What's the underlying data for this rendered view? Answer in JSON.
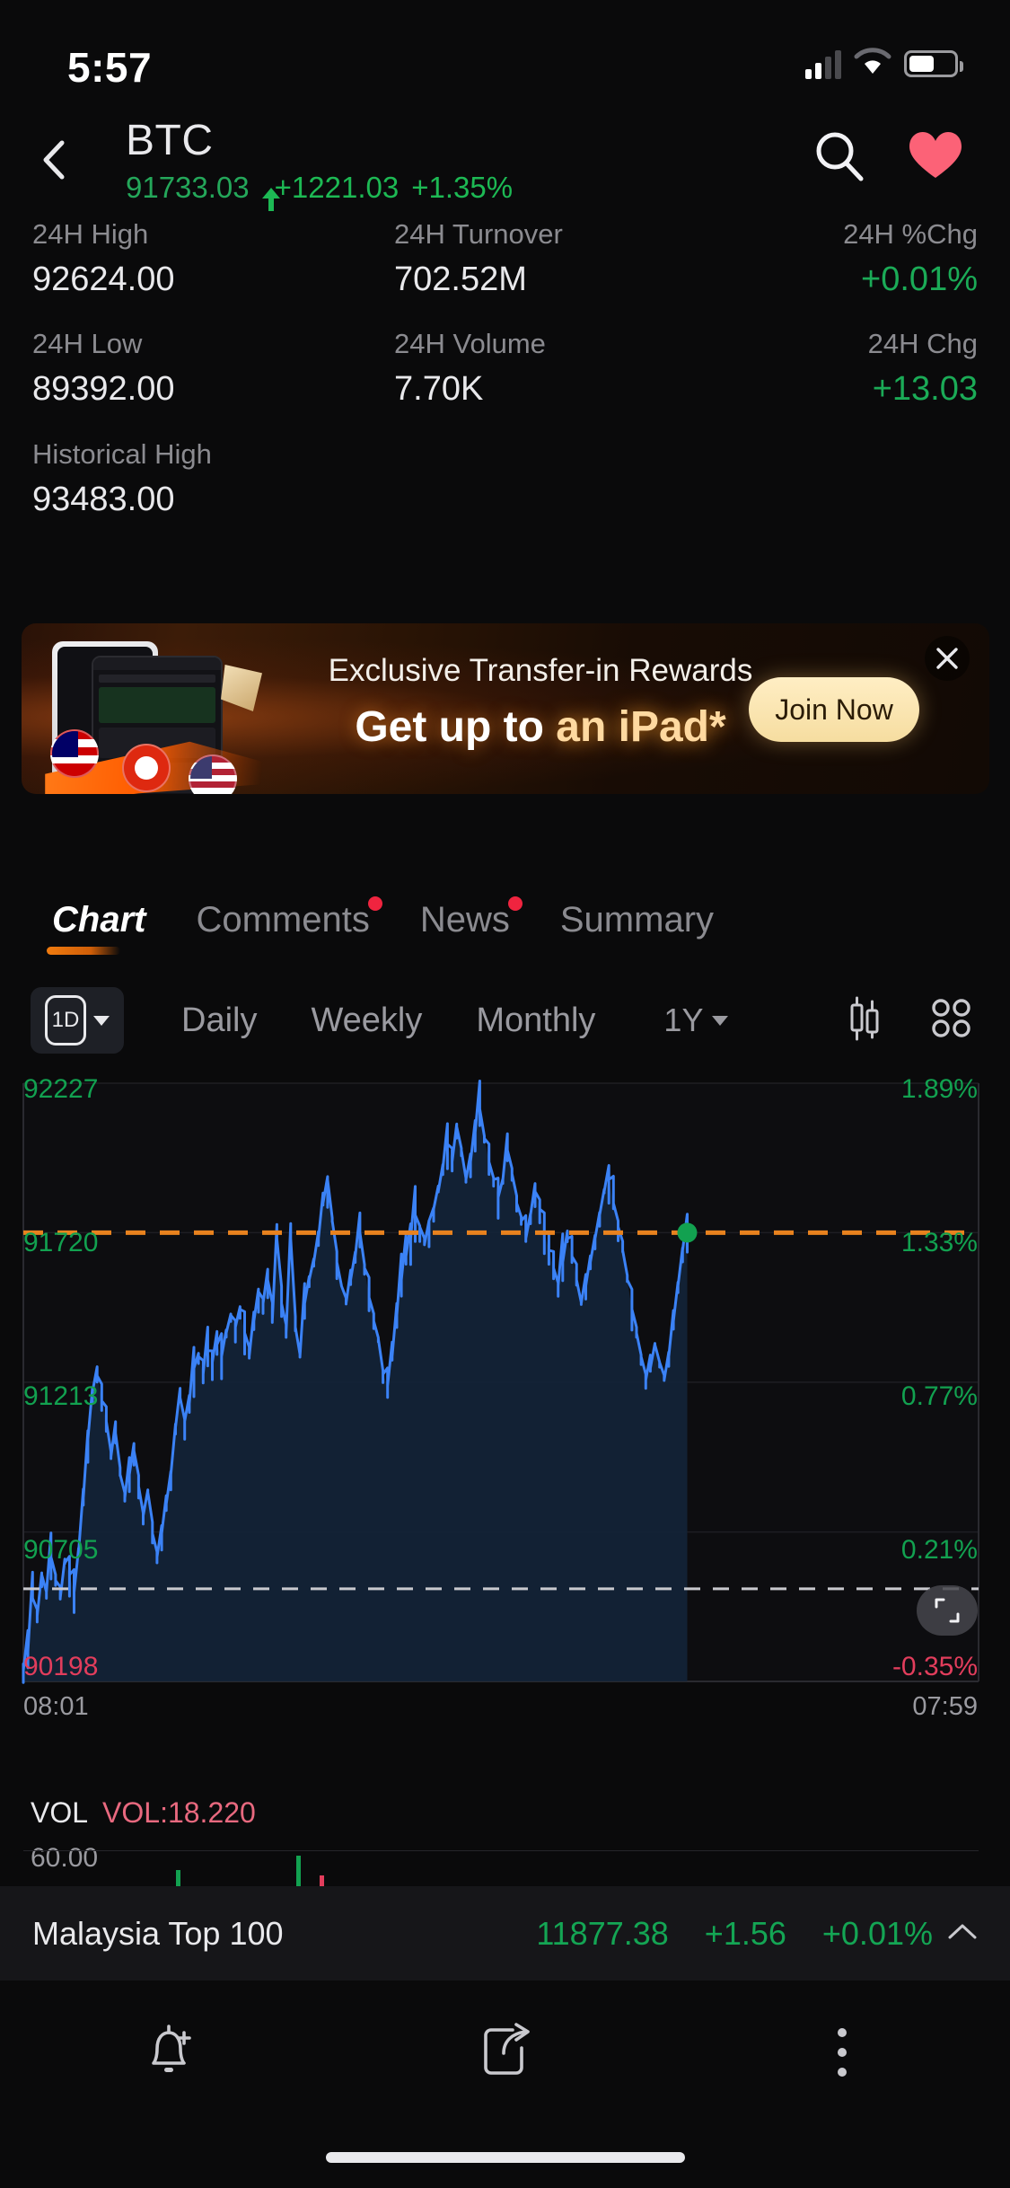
{
  "status_bar": {
    "time": "5:57",
    "signal_icon": "cellular-signal-icon",
    "wifi_icon": "wifi-icon",
    "battery_icon": "battery-icon"
  },
  "header": {
    "back_icon": "back-chevron-icon",
    "symbol": "BTC",
    "last_price": "91733.03",
    "direction_icon": "arrow-up-icon",
    "change_abs": "+1221.03",
    "change_pct": "+1.35%",
    "search_icon": "search-icon",
    "favorite_icon": "heart-icon"
  },
  "stats": [
    [
      {
        "label": "24H High",
        "value": "92624.00",
        "tone": "neutral"
      },
      {
        "label": "24H Turnover",
        "value": "702.52M",
        "tone": "neutral"
      },
      {
        "label": "24H %Chg",
        "value": "+0.01%",
        "tone": "up"
      }
    ],
    [
      {
        "label": "24H Low",
        "value": "89392.00",
        "tone": "neutral"
      },
      {
        "label": "24H Volume",
        "value": "7.70K",
        "tone": "neutral"
      },
      {
        "label": "24H Chg",
        "value": "+13.03",
        "tone": "up"
      }
    ],
    [
      {
        "label": "Historical High",
        "value": "93483.00",
        "tone": "neutral"
      }
    ]
  ],
  "banner": {
    "subtitle": "Exclusive Transfer-in Rewards",
    "title_plain": "Get up to ",
    "title_accent": "an iPad*",
    "cta_label": "Join Now",
    "close_icon": "close-icon",
    "flags": [
      "malaysia-flag-icon",
      "hong-kong-flag-icon",
      "usa-flag-icon"
    ]
  },
  "tabs": [
    {
      "label": "Chart",
      "active": true,
      "badge": false
    },
    {
      "label": "Comments",
      "active": false,
      "badge": true
    },
    {
      "label": "News",
      "active": false,
      "badge": true
    },
    {
      "label": "Summary",
      "active": false,
      "badge": false
    }
  ],
  "chart_controls": {
    "period_chip": "1D",
    "chip_caret_icon": "chevron-down-icon",
    "items": [
      "Daily",
      "Weekly",
      "Monthly"
    ],
    "range_label": "1Y",
    "range_caret_icon": "chevron-down-icon",
    "candle_icon": "candlestick-icon",
    "grid_icon": "grid-layout-icon",
    "expand_icon": "fullscreen-expand-icon"
  },
  "chart_data": {
    "type": "line",
    "title": "BTC intraday price",
    "xlabel": "",
    "ylabel": "",
    "x_ticks": [
      "08:01",
      "07:59"
    ],
    "y_ticks": [
      "92227",
      "91720",
      "91213",
      "90705",
      "90198"
    ],
    "y_tick_tones": [
      "up",
      "up",
      "up",
      "up",
      "down"
    ],
    "right_ticks": [
      "1.89%",
      "1.33%",
      "0.77%",
      "0.21%",
      "-0.35%"
    ],
    "right_tick_tones": [
      "up",
      "up",
      "up",
      "up",
      "down"
    ],
    "ylim": [
      90198,
      92227
    ],
    "prev_close_line": 91720,
    "prev_close_pct": "1.33%",
    "baseline_line": 90512,
    "last_point_marker": "green-dot",
    "line_color": "#3b82f6",
    "fill_color": "#132438",
    "prev_close_color": "#e8821e",
    "up_color": "#12a150",
    "down_color": "#e23d5c",
    "grid": true,
    "values": [
      90235,
      90300,
      90480,
      90420,
      90560,
      90500,
      90620,
      90540,
      90480,
      90600,
      90560,
      90500,
      90640,
      90820,
      91020,
      91180,
      91235,
      91150,
      91080,
      90960,
      91040,
      90900,
      90820,
      90900,
      90980,
      90860,
      90760,
      90840,
      90700,
      90620,
      90700,
      90800,
      90900,
      91060,
      91160,
      91080,
      91140,
      91260,
      91300,
      91240,
      91320,
      91280,
      91340,
      91300,
      91380,
      91440,
      91400,
      91460,
      91380,
      91300,
      91420,
      91520,
      91480,
      91560,
      91420,
      91700,
      91480,
      91380,
      91700,
      91400,
      91300,
      91480,
      91560,
      91620,
      91700,
      91820,
      91900,
      91760,
      91620,
      91540,
      91480,
      91560,
      91640,
      91720,
      91600,
      91500,
      91420,
      91360,
      91240,
      91200,
      91300,
      91440,
      91560,
      91640,
      91700,
      91780,
      91740,
      91680,
      91760,
      91800,
      91860,
      91940,
      92020,
      91960,
      92080,
      92000,
      91900,
      91960,
      92060,
      92140,
      92040,
      91960,
      91900,
      91840,
      91900,
      92000,
      91920,
      91820,
      91760,
      91700,
      91780,
      91860,
      91800,
      91720,
      91660,
      91600,
      91540,
      91620,
      91700,
      91640,
      91560,
      91480,
      91540,
      91620,
      91700,
      91780,
      91860,
      91900,
      91820,
      91740,
      91660,
      91560,
      91460,
      91380,
      91300,
      91220,
      91260,
      91340,
      91280,
      91220,
      91300,
      91420,
      91540,
      91660,
      91733
    ],
    "volume": {
      "label": "VOL",
      "readout": "VOL:18.220",
      "axis_max": "60.00"
    }
  },
  "index_bar": {
    "name": "Malaysia Top 100",
    "value": "11877.38",
    "change_abs": "+1.56",
    "change_pct": "+0.01%",
    "chevron_icon": "chevron-up-icon"
  },
  "bottom_bar": [
    {
      "icon": "alert-bell-add-icon"
    },
    {
      "icon": "share-icon"
    },
    {
      "icon": "more-vertical-icon"
    }
  ]
}
